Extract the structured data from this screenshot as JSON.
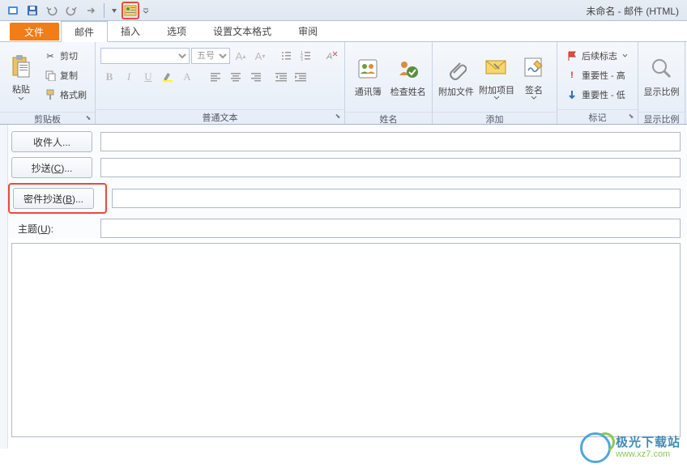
{
  "window_title": "未命名 - 邮件 (HTML)",
  "tabs": {
    "file": "文件",
    "mail": "邮件",
    "insert": "插入",
    "options": "选项",
    "format": "设置文本格式",
    "review": "审阅"
  },
  "ribbon": {
    "clipboard": {
      "paste": "粘贴",
      "cut": "剪切",
      "copy": "复制",
      "format_painter": "格式刷",
      "label": "剪贴板"
    },
    "font": {
      "size_placeholder": "五号",
      "label": "普通文本"
    },
    "names": {
      "address_book": "通讯簿",
      "check_names": "检查姓名",
      "label": "姓名"
    },
    "add": {
      "attach_file": "附加文件",
      "attach_item": "附加项目",
      "signature": "签名",
      "label": "添加"
    },
    "tags": {
      "follow_up": "后续标志",
      "importance_high": "重要性 - 高",
      "importance_low": "重要性 - 低",
      "label": "标记"
    },
    "zoom": {
      "zoom": "显示比例",
      "label": "显示比例"
    }
  },
  "form": {
    "to": "收件人...",
    "cc": "抄送(C)...",
    "bcc": "密件抄送(B)...",
    "subject": "主题(U):"
  },
  "watermark": {
    "cn": "极光下载站",
    "en": "www.xz7.com"
  }
}
